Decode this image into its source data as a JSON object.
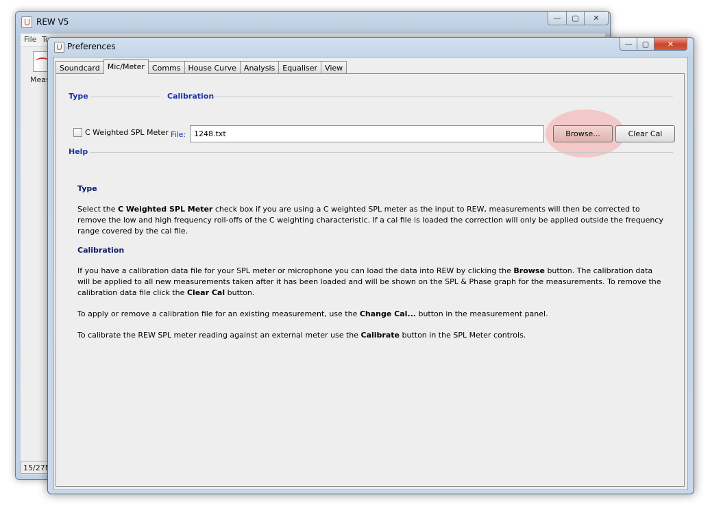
{
  "bg_window": {
    "title": "REW V5",
    "controls": {
      "minimize": "—",
      "maximize": "▢",
      "close": "✕"
    },
    "menu": [
      "File",
      "To"
    ],
    "meas_label": "Meas",
    "status": "15/27M"
  },
  "dialog": {
    "title": "Preferences",
    "controls": {
      "minimize": "—",
      "maximize": "▢",
      "close": "✕"
    },
    "tabs": [
      "Soundcard",
      "Mic/Meter",
      "Comms",
      "House Curve",
      "Analysis",
      "Equaliser",
      "View"
    ],
    "active_tab": "Mic/Meter"
  },
  "type_section": {
    "header": "Type",
    "checkbox_label": "C Weighted SPL Meter",
    "checked": false
  },
  "calibration_section": {
    "header": "Calibration",
    "file_label": "File:",
    "file_value": "1248.txt",
    "browse_label": "Browse...",
    "clear_label": "Clear Cal"
  },
  "help_section": {
    "header": "Help",
    "type_title": "Type",
    "type_text": {
      "t1": "Select the ",
      "b1": "C Weighted SPL Meter",
      "t2": " check box if you are using a C weighted SPL meter as the input to REW, measurements will then be corrected to remove the low and high frequency roll-offs of the C weighting characteristic. If a cal file is loaded the correction will only be applied outside the frequency range covered by the cal file."
    },
    "cal_title": "Calibration",
    "cal_text1": {
      "t1": "If you have a calibration data file for your SPL meter or microphone you can load the data into REW by clicking the ",
      "b1": "Browse",
      "t2": " button. The calibration data will be applied to all new measurements taken after it has been loaded and will be shown on the SPL & Phase graph for the measurements. To remove the calibration data file click the ",
      "b2": "Clear Cal",
      "t3": " button."
    },
    "cal_text2": {
      "t1": "To apply or remove a calibration file for an existing measurement, use the ",
      "b1": "Change Cal...",
      "t2": " button in the measurement panel."
    },
    "cal_text3": {
      "t1": "To calibrate the REW SPL meter reading against an external meter use the ",
      "b1": "Calibrate",
      "t2": " button in the SPL Meter controls."
    }
  },
  "colors": {
    "section_header": "#1c2fa8",
    "help_title": "#0a1a66",
    "highlight": "#f5aaaa"
  }
}
